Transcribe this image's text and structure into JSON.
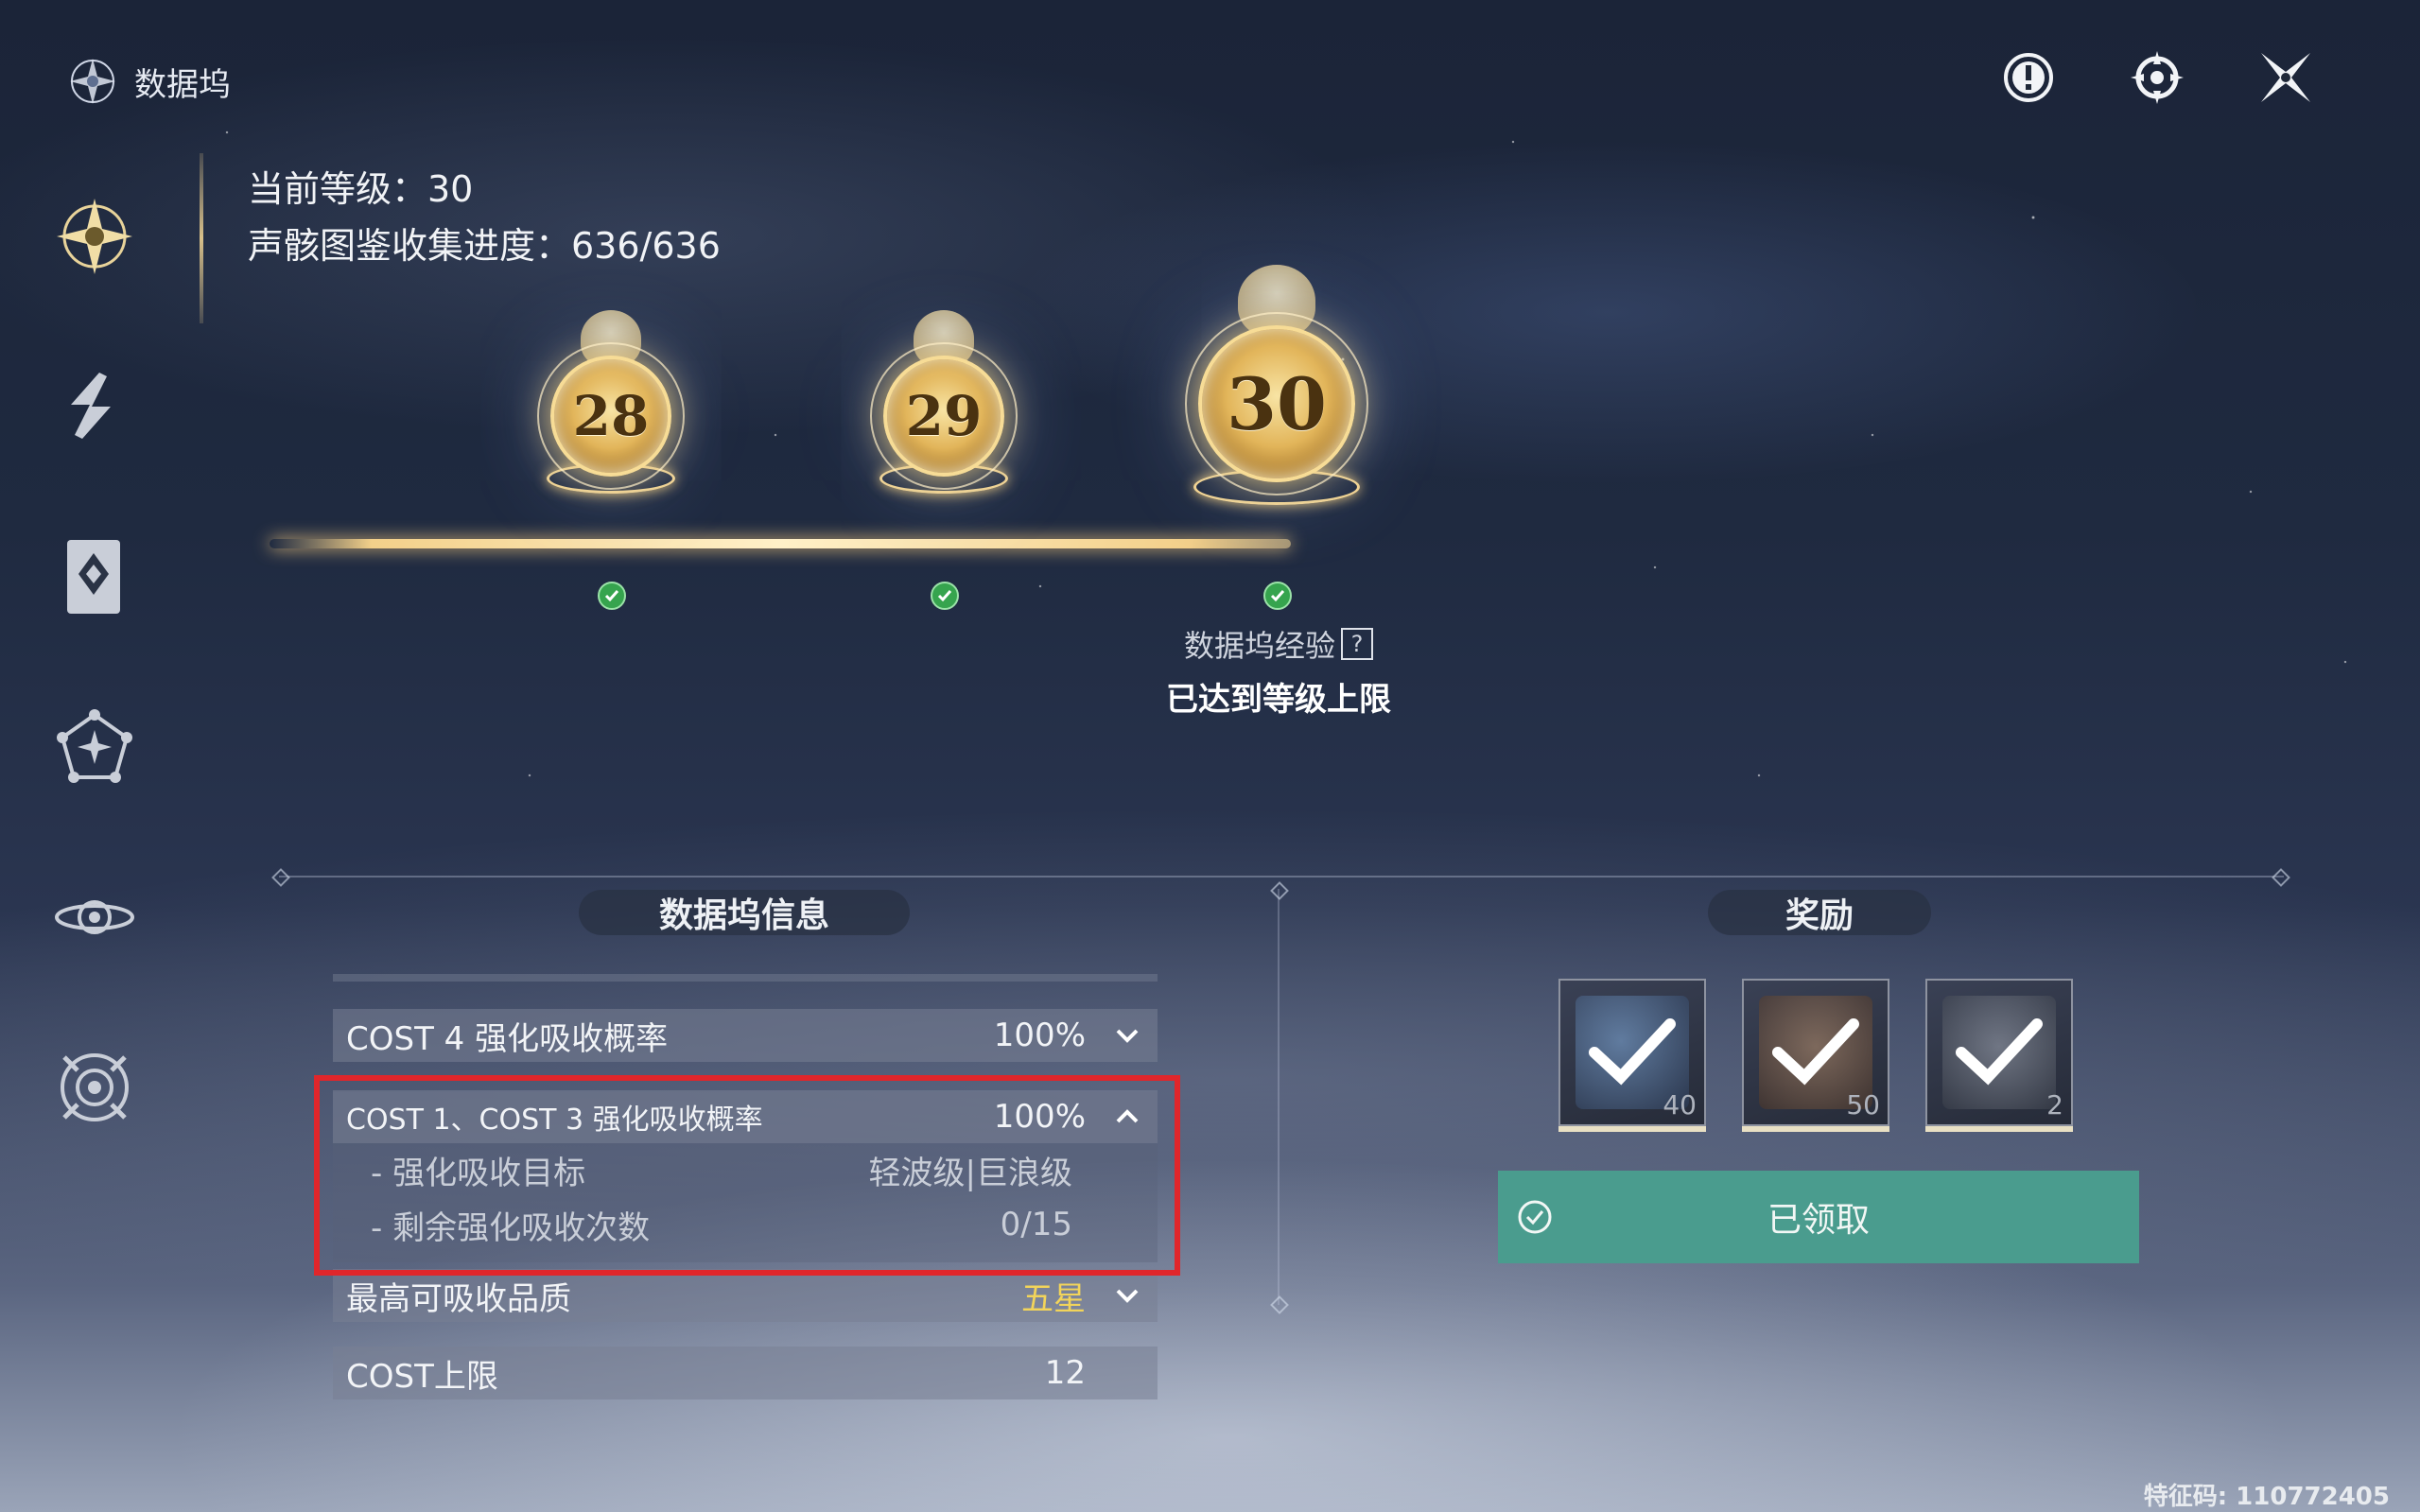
{
  "header": {
    "title": "数据坞"
  },
  "top_icons": [
    "alert-icon",
    "gear-target-icon",
    "close-icon"
  ],
  "sidebar": {
    "items": [
      {
        "icon": "star-compass-icon",
        "active": true
      },
      {
        "icon": "layered-arrow-icon",
        "active": false
      },
      {
        "icon": "card-book-icon",
        "active": false
      },
      {
        "icon": "pentagon-star-icon",
        "active": false
      },
      {
        "icon": "eye-orbit-icon",
        "active": false
      },
      {
        "icon": "crosshair-ring-icon",
        "active": false
      }
    ]
  },
  "level_info": {
    "current_level": "当前等级：30",
    "collection_progress": "声骸图鉴收集进度：636/636"
  },
  "levels": [
    {
      "number": "28",
      "completed": true
    },
    {
      "number": "29",
      "completed": true
    },
    {
      "number": "30",
      "completed": true
    }
  ],
  "exp": {
    "label": "数据坞经验",
    "help": "?",
    "status": "已达到等级上限"
  },
  "info_section": {
    "title": "数据坞信息",
    "rows": [
      {
        "label": "COST 4 强化吸收概率",
        "value": "100%"
      },
      {
        "label": "COST 1、COST 3 强化吸收概率",
        "value": "100%"
      }
    ],
    "sub_rows": [
      {
        "label": "- 强化吸收目标",
        "value": "轻波级|巨浪级"
      },
      {
        "label": "- 剩余强化吸收次数",
        "value": "0/15"
      }
    ],
    "quality_row": {
      "label": "最高可吸收品质",
      "value": "五星"
    },
    "cost_row": {
      "label": "COST上限",
      "value": "12"
    }
  },
  "reward_section": {
    "title": "奖励",
    "items": [
      {
        "icon": "crystal-shard-icon",
        "count": "40",
        "claimed": true
      },
      {
        "icon": "tuning-module-icon",
        "count": "50",
        "claimed": true
      },
      {
        "icon": "sealed-tube-icon",
        "count": "2",
        "claimed": true
      }
    ],
    "claim_button": "已领取"
  },
  "footer": {
    "code": "特征码: 110772405"
  },
  "colors": {
    "accent_gold": "#f2d45a",
    "claim_green": "#4a9c8e",
    "highlight_red": "#e0262b"
  }
}
